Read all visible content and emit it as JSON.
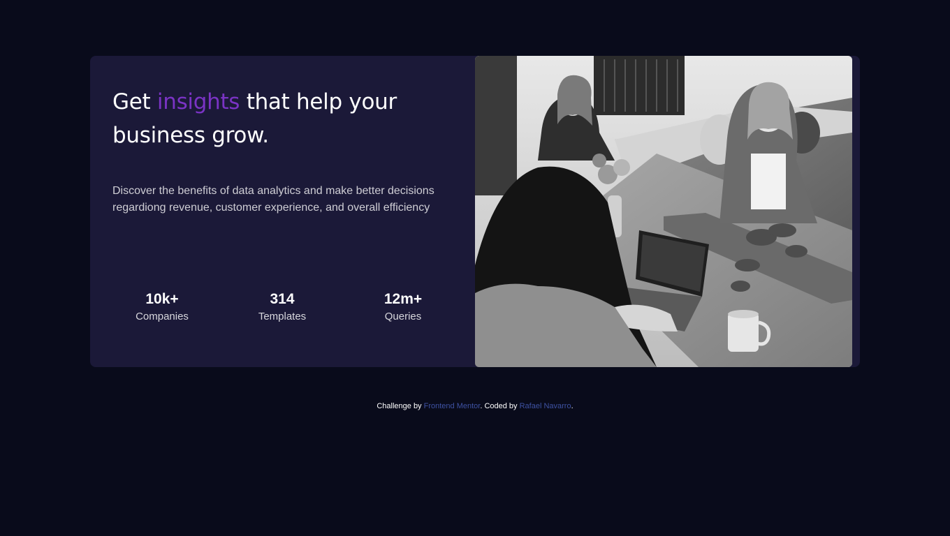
{
  "hero": {
    "title_prefix": "Get ",
    "title_accent": "insights",
    "title_suffix": " that help your business grow.",
    "description": "Discover the benefits of data analytics and make better decisions regardiong revenue, customer experience, and overall efficiency"
  },
  "stats": [
    {
      "value": "10k+",
      "label": "Companies"
    },
    {
      "value": "314",
      "label": "Templates"
    },
    {
      "value": "12m+",
      "label": "Queries"
    }
  ],
  "image": {
    "description_icon": "office-photo"
  },
  "footer": {
    "prefix": "Challenge by ",
    "link1": "Frontend Mentor",
    "middle": ". Coded by ",
    "link2": "Rafael Navarro",
    "suffix": "."
  },
  "colors": {
    "background": "#090b1b",
    "card": "#1b1938",
    "accent": "#7a33c4",
    "link": "#3e52a3"
  }
}
